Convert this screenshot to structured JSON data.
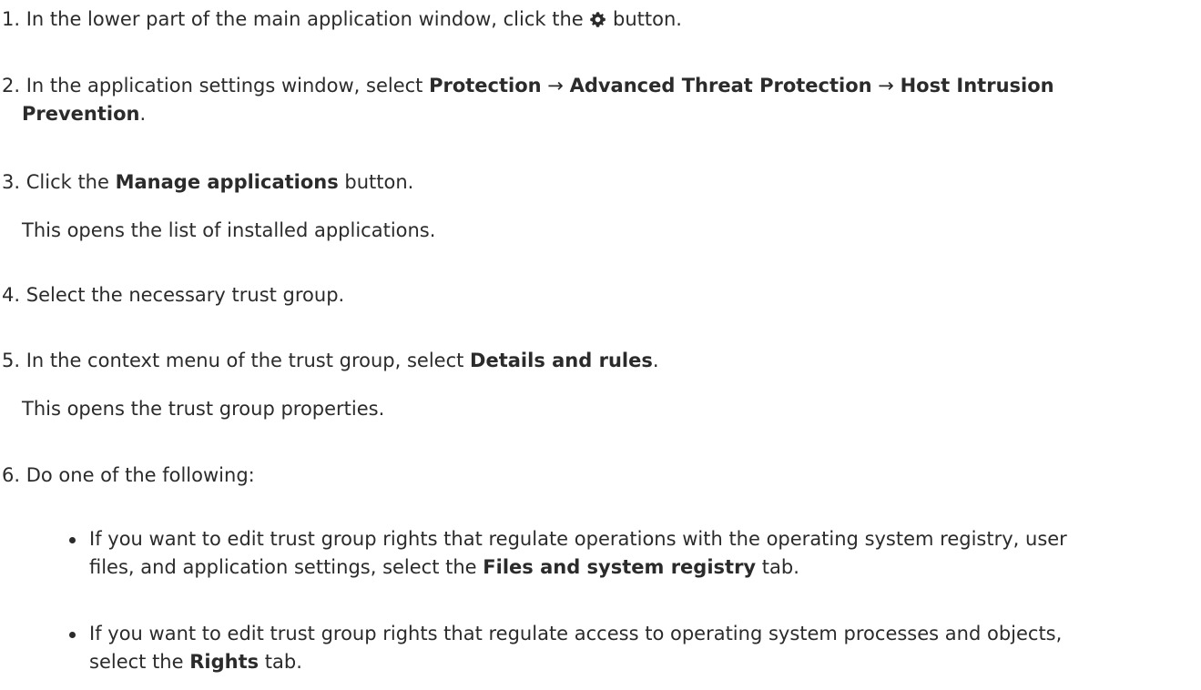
{
  "steps": {
    "s1": {
      "num": "1.",
      "a": "In the lower part of the main application window, click the ",
      "icon": "gear-icon",
      "b": " button."
    },
    "s2": {
      "num": "2.",
      "a": "In the application settings window, select ",
      "p1": "Protection",
      "arrow1": " → ",
      "p2": "Advanced Threat Protection",
      "arrow2": " → ",
      "p3a": "Host Intrusion",
      "p3b": "Prevention",
      "end": "."
    },
    "s3": {
      "num": "3.",
      "a": "Click the ",
      "bold": "Manage applications",
      "b": " button.",
      "note": "This opens the list of installed applications."
    },
    "s4": {
      "num": "4.",
      "a": "Select the necessary trust group."
    },
    "s5": {
      "num": "5.",
      "a": "In the context menu of the trust group, select ",
      "bold": "Details and rules",
      "end": ".",
      "note": "This opens the trust group properties."
    },
    "s6": {
      "num": "6.",
      "a": "Do one of the following:"
    }
  },
  "bullets": [
    {
      "l1": "If you want to edit trust group rights that regulate operations with the operating system registry, user",
      "l2a": "files, and application settings, select the ",
      "bold": "Files and system registry",
      "l2b": " tab."
    },
    {
      "l1": "If you want to edit trust group rights that regulate access to operating system processes and objects,",
      "l2a": "select the ",
      "bold": "Rights",
      "l2b": " tab."
    }
  ]
}
